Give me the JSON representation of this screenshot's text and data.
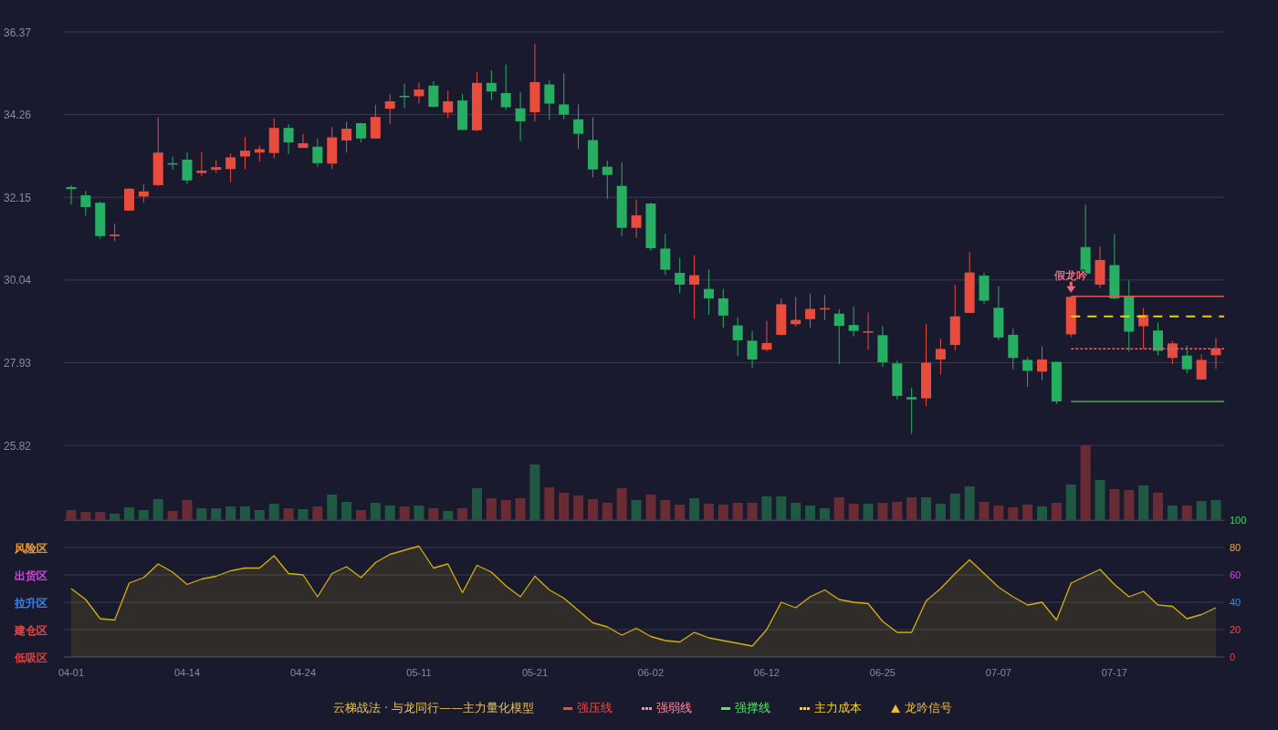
{
  "price_panel": {
    "chart_data": {
      "type": "candlestick",
      "grid": true,
      "ylim": [
        25.82,
        36.37
      ],
      "yticks": [
        36.37,
        34.26,
        32.15,
        30.04,
        27.93,
        25.82
      ],
      "categories": [
        null,
        null,
        null,
        null,
        null,
        null,
        null,
        null,
        null,
        null,
        null,
        null,
        null,
        null,
        null,
        null,
        null,
        null,
        null,
        null,
        null,
        null,
        null,
        null,
        null,
        null,
        null,
        null,
        null,
        null,
        null,
        null,
        null,
        null,
        null,
        null,
        null,
        null,
        null,
        null,
        null,
        null,
        null,
        null,
        null,
        null,
        null,
        null,
        null,
        null,
        null,
        null,
        null,
        null,
        null,
        null,
        null,
        null,
        null,
        null,
        null,
        null,
        null,
        null,
        null,
        null,
        null,
        null,
        null,
        null,
        null,
        null,
        null,
        null,
        null,
        null,
        null,
        null,
        null,
        null
      ],
      "ohlc": [
        [
          32.41,
          32.46,
          31.96,
          32.36
        ],
        [
          32.2,
          32.31,
          31.68,
          31.9
        ],
        [
          32.01,
          32.04,
          31.09,
          31.16
        ],
        [
          31.16,
          31.48,
          31.03,
          31.2
        ],
        [
          31.81,
          32.38,
          31.8,
          32.37
        ],
        [
          32.17,
          32.49,
          32.02,
          32.3
        ],
        [
          32.46,
          34.19,
          32.44,
          33.29
        ],
        [
          33.02,
          33.19,
          32.85,
          32.99
        ],
        [
          33.11,
          33.29,
          32.48,
          32.58
        ],
        [
          32.77,
          33.3,
          32.69,
          32.83
        ],
        [
          32.85,
          33.1,
          32.77,
          32.92
        ],
        [
          32.87,
          33.27,
          32.54,
          33.17
        ],
        [
          33.19,
          33.69,
          32.87,
          33.34
        ],
        [
          33.29,
          33.47,
          33.06,
          33.38
        ],
        [
          33.28,
          34.17,
          33.15,
          33.92
        ],
        [
          33.92,
          34.02,
          33.25,
          33.55
        ],
        [
          33.41,
          33.77,
          33.41,
          33.53
        ],
        [
          33.44,
          33.65,
          32.93,
          33.02
        ],
        [
          33.01,
          33.94,
          32.87,
          33.68
        ],
        [
          33.6,
          34.08,
          33.29,
          33.9
        ],
        [
          34.04,
          34.05,
          33.55,
          33.65
        ],
        [
          33.65,
          34.51,
          33.64,
          34.2
        ],
        [
          34.41,
          34.79,
          34.02,
          34.6
        ],
        [
          34.74,
          35.05,
          34.42,
          34.71
        ],
        [
          34.73,
          35.07,
          34.55,
          34.9
        ],
        [
          35.0,
          35.11,
          34.45,
          34.46
        ],
        [
          34.31,
          34.87,
          34.17,
          34.6
        ],
        [
          34.62,
          34.79,
          33.86,
          33.87
        ],
        [
          33.86,
          35.35,
          33.84,
          35.07
        ],
        [
          35.07,
          35.39,
          34.62,
          34.85
        ],
        [
          34.81,
          35.54,
          34.38,
          34.45
        ],
        [
          34.42,
          34.84,
          33.58,
          34.09
        ],
        [
          34.32,
          36.07,
          34.08,
          35.09
        ],
        [
          35.03,
          35.14,
          34.12,
          34.54
        ],
        [
          34.52,
          35.31,
          34.14,
          34.26
        ],
        [
          34.14,
          34.52,
          33.38,
          33.77
        ],
        [
          33.61,
          34.19,
          32.66,
          32.86
        ],
        [
          32.93,
          33.09,
          32.11,
          32.72
        ],
        [
          32.44,
          33.04,
          31.16,
          31.37
        ],
        [
          31.37,
          32.09,
          31.12,
          31.69
        ],
        [
          31.99,
          32.01,
          30.78,
          30.85
        ],
        [
          30.84,
          31.21,
          30.17,
          30.3
        ],
        [
          30.22,
          30.61,
          29.7,
          29.92
        ],
        [
          29.92,
          30.67,
          29.05,
          30.16
        ],
        [
          29.81,
          30.31,
          29.15,
          29.57
        ],
        [
          29.57,
          29.81,
          28.82,
          29.13
        ],
        [
          28.88,
          29.09,
          28.1,
          28.5
        ],
        [
          28.49,
          28.74,
          27.8,
          28.01
        ],
        [
          28.26,
          29.0,
          28.22,
          28.43
        ],
        [
          28.64,
          29.57,
          28.63,
          29.42
        ],
        [
          28.91,
          29.61,
          28.85,
          29.02
        ],
        [
          29.04,
          29.69,
          28.82,
          29.3
        ],
        [
          29.29,
          29.66,
          29.01,
          29.32
        ],
        [
          29.18,
          29.29,
          27.89,
          28.87
        ],
        [
          28.89,
          29.37,
          28.6,
          28.74
        ],
        [
          28.71,
          29.21,
          28.26,
          28.73
        ],
        [
          28.63,
          28.86,
          27.82,
          27.94
        ],
        [
          27.91,
          27.98,
          26.99,
          27.08
        ],
        [
          27.05,
          27.29,
          26.11,
          26.99
        ],
        [
          27.02,
          28.91,
          26.82,
          27.93
        ],
        [
          28.01,
          28.54,
          27.63,
          28.28
        ],
        [
          28.38,
          29.92,
          28.24,
          29.11
        ],
        [
          29.2,
          30.75,
          29.19,
          30.23
        ],
        [
          30.15,
          30.23,
          29.42,
          29.51
        ],
        [
          29.33,
          29.88,
          28.5,
          28.57
        ],
        [
          28.64,
          28.8,
          27.76,
          28.05
        ],
        [
          28.0,
          28.07,
          27.31,
          27.72
        ],
        [
          27.7,
          28.34,
          27.48,
          28.01
        ],
        [
          27.95,
          27.95,
          26.87,
          26.94
        ],
        [
          28.65,
          29.62,
          28.58,
          29.61
        ],
        [
          30.88,
          31.96,
          30.19,
          30.2
        ],
        [
          29.92,
          30.9,
          29.83,
          30.55
        ],
        [
          30.42,
          31.21,
          29.55,
          29.57
        ],
        [
          29.64,
          30.03,
          28.21,
          28.72
        ],
        [
          28.86,
          29.33,
          28.28,
          29.15
        ],
        [
          28.75,
          28.95,
          28.11,
          28.23
        ],
        [
          28.05,
          28.48,
          27.89,
          28.42
        ],
        [
          28.11,
          28.37,
          27.66,
          27.76
        ],
        [
          27.5,
          28.14,
          27.49,
          28.0
        ],
        [
          28.12,
          28.56,
          27.77,
          28.29
        ]
      ],
      "annotations": [
        {
          "text": "假龙吟",
          "y": 29.62
        }
      ],
      "ref_lines": [
        {
          "axis": "y",
          "value": 29.62,
          "color": "#e05555"
        },
        {
          "axis": "y",
          "value": 29.11,
          "color": "#f0d000"
        },
        {
          "axis": "y",
          "value": 28.28,
          "color": "#d86878"
        },
        {
          "axis": "y",
          "value": 26.94,
          "color": "#4cae50"
        }
      ]
    }
  },
  "indicator_panel": {
    "zone_labels": [
      {
        "label": "风险区",
        "color": "#f5a030"
      },
      {
        "label": "出货区",
        "color": "#e040e8"
      },
      {
        "label": "拉升区",
        "color": "#3d8bf0"
      },
      {
        "label": "建仓区",
        "color": "#f04848"
      },
      {
        "label": "低吸区",
        "color": "#ee3c3c"
      }
    ],
    "chart_data": {
      "type": "area",
      "grid": true,
      "ylim": [
        0,
        100
      ],
      "yticks": [
        100,
        80,
        60,
        40,
        20,
        0
      ],
      "categories": [
        "04-01",
        null,
        null,
        null,
        null,
        null,
        null,
        null,
        "04-14",
        null,
        null,
        null,
        null,
        null,
        null,
        null,
        "04-24",
        null,
        null,
        null,
        null,
        null,
        null,
        null,
        "05-11",
        null,
        null,
        null,
        null,
        null,
        null,
        null,
        "05-21",
        null,
        null,
        null,
        null,
        null,
        null,
        null,
        "06-02",
        null,
        null,
        null,
        null,
        null,
        null,
        null,
        "06-12",
        null,
        null,
        null,
        null,
        null,
        null,
        null,
        "06-25",
        null,
        null,
        null,
        null,
        null,
        null,
        null,
        "07-07",
        null,
        null,
        null,
        null,
        null,
        null,
        null,
        "07-17",
        null,
        null,
        null,
        null,
        null,
        null,
        null
      ],
      "values": [
        50,
        42,
        28,
        27,
        54,
        58,
        68,
        62,
        53,
        57,
        59,
        63,
        65,
        65,
        74,
        61,
        60,
        44,
        61,
        66,
        58,
        69,
        75,
        78,
        81,
        65,
        68,
        47,
        67,
        62,
        52,
        44,
        59,
        49,
        43,
        34,
        25,
        22,
        16,
        21,
        15,
        12,
        11,
        18,
        14,
        12,
        10,
        8,
        20,
        40,
        36,
        44,
        49,
        42,
        40,
        39,
        26,
        18,
        18,
        41,
        50,
        61,
        71,
        61,
        51,
        44,
        38,
        40,
        27,
        54,
        59,
        64,
        53,
        44,
        48,
        38,
        37,
        28,
        31,
        36
      ]
    }
  },
  "legend": {
    "title": "云梯战法 · 与龙同行——主力量化模型",
    "items": [
      {
        "label": "强压线",
        "kind": "solid",
        "color": "#f04848"
      },
      {
        "label": "强弱线",
        "kind": "dashed",
        "color": "#ff8c9c"
      },
      {
        "label": "强撑线",
        "kind": "solid",
        "color": "#55e66a"
      },
      {
        "label": "主力成本",
        "kind": "dashed",
        "color": "#ffd21f"
      },
      {
        "label": "龙吟信号",
        "kind": "triangle",
        "color": "#f2b93b"
      }
    ]
  }
}
